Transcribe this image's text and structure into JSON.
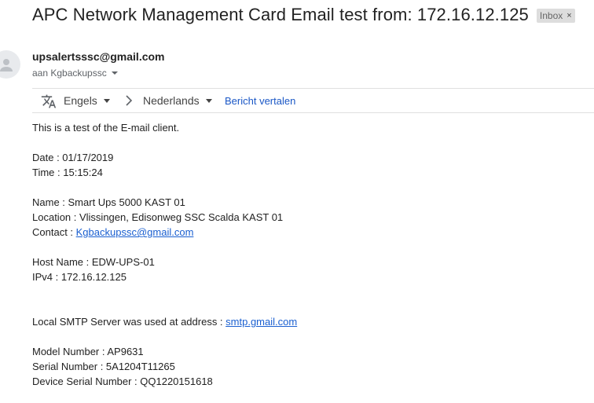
{
  "email": {
    "subject": "APC Network Management Card Email test from: 172.16.12.125",
    "label": "Inbox",
    "label_close": "×",
    "sender": "upsalertsssc@gmail.com",
    "recipient": "aan Kgbackupssc"
  },
  "translate_bar": {
    "from_language": "Engels",
    "to_language": "Nederlands",
    "translate_link": "Bericht vertalen"
  },
  "body": {
    "intro": "This is a test of the E-mail client.",
    "date": "Date : 01/17/2019",
    "time": "Time : 15:15:24",
    "name": "Name : Smart Ups 5000 KAST 01",
    "location": "Location : Vlissingen, Edisonweg SSC Scalda KAST 01",
    "contact_label": "Contact : ",
    "contact_email": "Kgbackupssc@gmail.com",
    "host_name": "Host Name : EDW-UPS-01",
    "ipv4": "IPv4 : 172.16.12.125",
    "smtp_label": "Local SMTP Server was used at address : ",
    "smtp_address": "smtp.gmail.com",
    "model_number": "Model Number : AP9631",
    "serial_number": "Serial Number : 5A1204T11265",
    "device_serial_number": "Device Serial Number : QQ1220151618"
  },
  "icons": {
    "avatar": "person-avatar-icon",
    "recipient_toggle": "caret-down-icon",
    "translate": "translate-icon",
    "from_dropdown": "caret-down-icon",
    "direction": "chevron-right-icon",
    "to_dropdown": "caret-down-icon"
  }
}
